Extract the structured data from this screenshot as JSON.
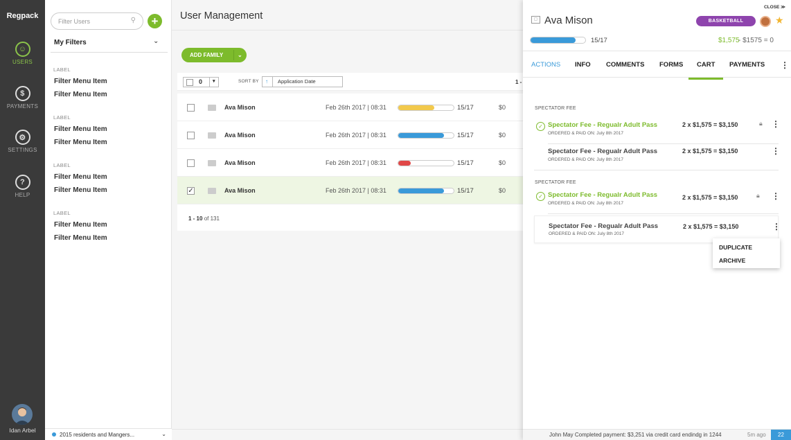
{
  "nav": {
    "logo": "Regpack",
    "items": [
      {
        "label": "USERS",
        "icon": "user-icon"
      },
      {
        "label": "PAYMENTS",
        "icon": "payments-icon"
      },
      {
        "label": "SETTINGS",
        "icon": "gear-icon"
      },
      {
        "label": "HELP",
        "icon": "help-icon"
      }
    ],
    "user_name": "Idan Arbel"
  },
  "filters": {
    "search_placeholder": "Filter Users",
    "my_filters": "My Filters",
    "groups": [
      {
        "label": "LABEL",
        "items": [
          "Filter Menu Item",
          "Filter Menu Item"
        ]
      },
      {
        "label": "LABEL",
        "items": [
          "Filter Menu Item",
          "Filter Menu Item"
        ]
      },
      {
        "label": "LABEL",
        "items": [
          "Filter Menu Item",
          "Filter Menu Item"
        ]
      },
      {
        "label": "LABEL",
        "items": [
          "Filter Menu Item",
          "Filter Menu Item"
        ]
      }
    ],
    "group_select": "2015 residents and Mangers..."
  },
  "main": {
    "title": "User Management",
    "add_family": "ADD FAMILY",
    "selected_count": "0",
    "sort_by": "SORT BY",
    "sort_field": "Application Date",
    "page_top": "1 -",
    "rows": [
      {
        "name": "Ava Mison",
        "date": "Feb 26th 2017 | 08:31",
        "progress": 0.65,
        "bar_color": "#f2c94c",
        "count": "15/17",
        "amount": "$0",
        "checked": false
      },
      {
        "name": "Ava Mison",
        "date": "Feb 26th 2017 | 08:31",
        "progress": 0.82,
        "bar_color": "#3a9ad9",
        "count": "15/17",
        "amount": "$0",
        "checked": false
      },
      {
        "name": "Ava Mison",
        "date": "Feb 26th 2017 | 08:31",
        "progress": 0.22,
        "bar_color": "#e04848",
        "count": "15/17",
        "amount": "$0",
        "checked": false
      },
      {
        "name": "Ava Mison",
        "date": "Feb 26th 2017 | 08:31",
        "progress": 0.82,
        "bar_color": "#3a9ad9",
        "count": "15/17",
        "amount": "$0",
        "checked": true
      }
    ],
    "pagination_range": "1 - 10",
    "pagination_total": " of 131"
  },
  "drawer": {
    "close": "CLOSE ≫",
    "name": "Ava Mison",
    "badge": "BASKETBALL",
    "progress": 0.82,
    "count": "15/17",
    "paid": "$1,575",
    "total": "-  $1575  =  0",
    "tabs": [
      "ACTIONS",
      "INFO",
      "COMMENTS",
      "FORMS",
      "CART",
      "PAYMENTS"
    ],
    "active_tab": "CART",
    "sections": [
      {
        "label": "SPECTATOR FEE",
        "items": [
          {
            "title": "Spectator Fee - Regualr Adult Pass",
            "sub": "ORDERED & PAID ON: July 8th 2017",
            "price": "2 x $1,575  =  $3,150",
            "paid": true,
            "locked": true
          },
          {
            "title": "Spectator Fee - Regualr Adult Pass",
            "sub": "ORDERED & PAID ON: July 8th 2017",
            "price": "2 x $1,575  =  $3,150",
            "paid": false,
            "locked": false
          }
        ]
      },
      {
        "label": "SPECTATOR FEE",
        "items": [
          {
            "title": "Spectator Fee - Regualr Adult Pass",
            "sub": "ORDERED & PAID ON: July 8th 2017",
            "price": "2 x $1,575  =  $3,150",
            "paid": true,
            "locked": true
          },
          {
            "title": "Spectator Fee - Regualr Adult Pass",
            "sub": "ORDERED & PAID ON: July 8th 2017",
            "price": "2 x $1,575  =  $3,150",
            "paid": false,
            "locked": false
          }
        ]
      }
    ],
    "menu": [
      "DUPLICATE",
      "ARCHIVE"
    ],
    "status_msg": "John May Completed payment: $3,251 via credit card endindg in 1244",
    "status_ago": "5m ago",
    "status_num": "22"
  }
}
